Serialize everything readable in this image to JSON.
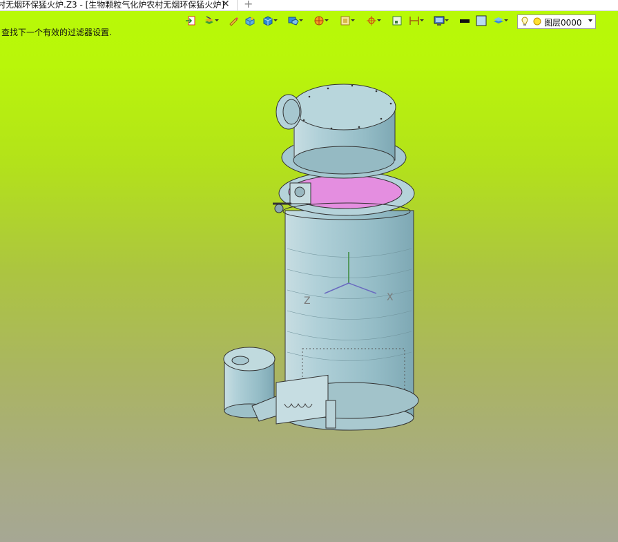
{
  "tab": {
    "title": "村无烟环保猛火炉.Z3 - [生物颗粒气化炉农村无烟环保猛火炉]",
    "close_glyph": "✕",
    "add_glyph": "+"
  },
  "status": {
    "hint": "查找下一个有效的过滤器设置."
  },
  "toolbar": {
    "items": [
      {
        "name": "exit-sketch-icon",
        "dropdown": false
      },
      {
        "name": "layer-stack-icon",
        "dropdown": true
      },
      {
        "name": "pencil-icon",
        "dropdown": false
      },
      {
        "name": "solid-box-icon",
        "dropdown": false
      },
      {
        "name": "cube-icon",
        "dropdown": true
      },
      {
        "name": "display-mode-icon",
        "dropdown": true
      },
      {
        "name": "section-view-icon",
        "dropdown": true
      },
      {
        "name": "frame-icon",
        "dropdown": true
      },
      {
        "name": "origin-point-icon",
        "dropdown": true
      },
      {
        "name": "rectangle-select-icon",
        "dropdown": false
      },
      {
        "name": "dimension-icon",
        "dropdown": true
      },
      {
        "name": "monitor-icon",
        "dropdown": true
      },
      {
        "name": "line-color-icon",
        "dropdown": false
      },
      {
        "name": "face-color-icon",
        "dropdown": false
      },
      {
        "name": "layer-manager-icon",
        "dropdown": true
      }
    ],
    "layer_select": {
      "value": "图层0000"
    }
  },
  "viewport": {
    "axis_x": "X",
    "axis_z": "Z"
  },
  "colors": {
    "background_top": "#b8fa06",
    "background_bottom": "#a6a794",
    "model_body": "#9fc4cc",
    "model_highlight": "#e48ee0"
  }
}
